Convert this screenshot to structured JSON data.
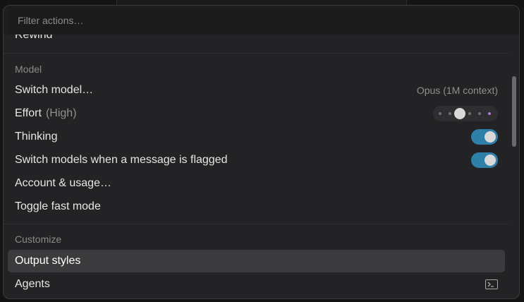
{
  "search": {
    "placeholder": "Filter actions…"
  },
  "items_top": {
    "rewind_label": "Rewind"
  },
  "model_section": {
    "header": "Model",
    "switch_model": {
      "label": "Switch model…",
      "current": "Opus (1M context)"
    },
    "effort": {
      "label": "Effort",
      "level": "(High)",
      "levels_count": 6,
      "selected_index": 2,
      "max_index": 5
    },
    "thinking": {
      "label": "Thinking",
      "enabled": true
    },
    "switch_on_flag": {
      "label": "Switch models when a message is flagged",
      "enabled": true
    },
    "account": {
      "label": "Account & usage…"
    },
    "fast_mode": {
      "label": "Toggle fast mode"
    }
  },
  "customize_section": {
    "header": "Customize",
    "output_styles": {
      "label": "Output styles",
      "selected": true
    },
    "agents": {
      "label": "Agents",
      "icon": "terminal-icon"
    }
  },
  "colors": {
    "accent_toggle": "#2f80a8",
    "effort_max_dot": "#b07ad6",
    "selected_row": "#3b3b3d"
  }
}
